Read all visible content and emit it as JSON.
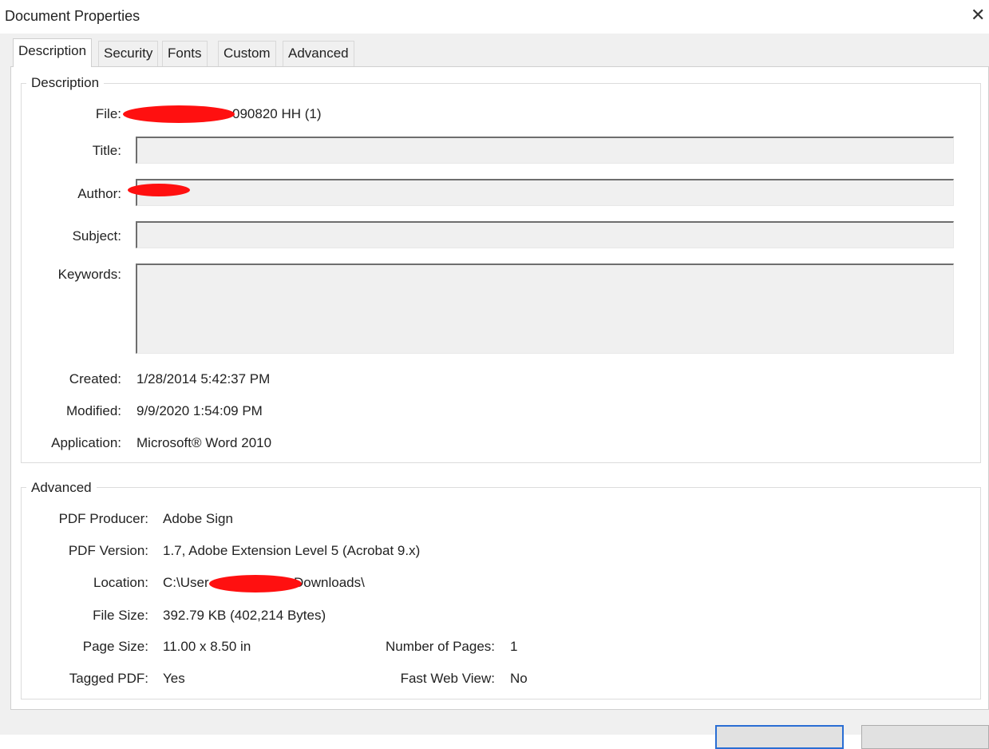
{
  "window": {
    "title": "Document Properties",
    "close_glyph": "✕"
  },
  "tabs": [
    {
      "label": "Description",
      "active": true
    },
    {
      "label": "Security",
      "active": false
    },
    {
      "label": "Fonts",
      "active": false
    },
    {
      "label": "Custom",
      "active": false
    },
    {
      "label": "Advanced",
      "active": false
    }
  ],
  "description": {
    "legend": "Description",
    "file_label": "File:",
    "file_value": "090820 HH (1)",
    "title_label": "Title:",
    "title_value": "",
    "author_label": "Author:",
    "author_value": "",
    "subject_label": "Subject:",
    "subject_value": "",
    "keywords_label": "Keywords:",
    "keywords_value": "",
    "created_label": "Created:",
    "created_value": "1/28/2014 5:42:37 PM",
    "modified_label": "Modified:",
    "modified_value": "9/9/2020 1:54:09 PM",
    "application_label": "Application:",
    "application_value": "Microsoft® Word 2010"
  },
  "advanced": {
    "legend": "Advanced",
    "producer_label": "PDF Producer:",
    "producer_value": "Adobe Sign",
    "version_label": "PDF Version:",
    "version_value": "1.7, Adobe Extension Level 5 (Acrobat 9.x)",
    "location_label": "Location:",
    "location_prefix": "C:\\User",
    "location_suffix": "Downloads\\",
    "filesize_label": "File Size:",
    "filesize_value": "392.79 KB (402,214 Bytes)",
    "pagesize_label": "Page Size:",
    "pagesize_value": "11.00 x 8.50 in",
    "numpages_label": "Number of Pages:",
    "numpages_value": "1",
    "tagged_label": "Tagged PDF:",
    "tagged_value": "Yes",
    "fastweb_label": "Fast Web View:",
    "fastweb_value": "No"
  },
  "colors": {
    "redaction": "#ff1010",
    "accent": "#2a6ed4"
  }
}
